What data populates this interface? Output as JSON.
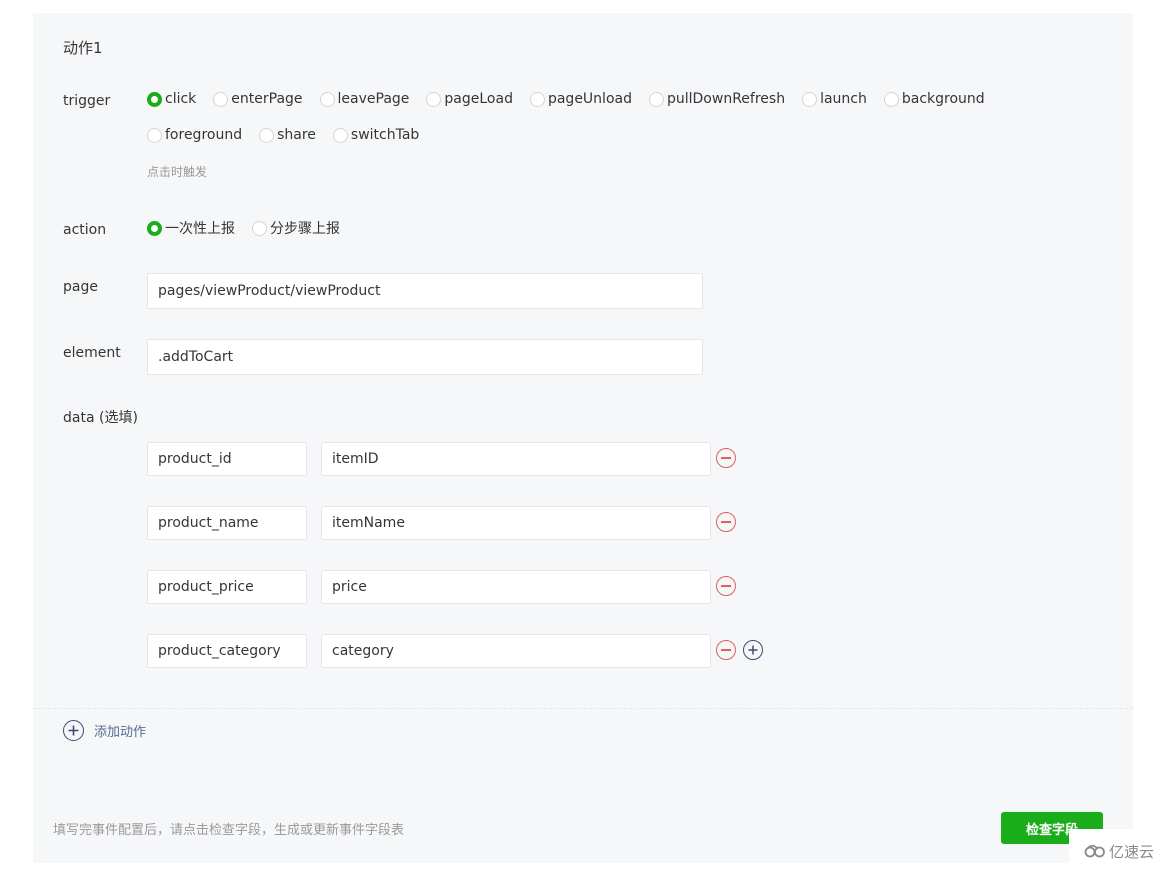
{
  "action": {
    "title": "动作1",
    "trigger": {
      "label": "trigger",
      "options_row1": [
        {
          "label": "click",
          "checked": true
        },
        {
          "label": "enterPage",
          "checked": false
        },
        {
          "label": "leavePage",
          "checked": false
        },
        {
          "label": "pageLoad",
          "checked": false
        },
        {
          "label": "pageUnload",
          "checked": false
        },
        {
          "label": "pullDownRefresh",
          "checked": false
        },
        {
          "label": "launch",
          "checked": false
        },
        {
          "label": "background",
          "checked": false
        }
      ],
      "options_row2": [
        {
          "label": "foreground",
          "checked": false
        },
        {
          "label": "share",
          "checked": false
        },
        {
          "label": "switchTab",
          "checked": false
        }
      ],
      "hint": "点击时触发"
    },
    "report": {
      "label": "action",
      "options": [
        {
          "label": "一次性上报",
          "checked": true
        },
        {
          "label": "分步骤上报",
          "checked": false
        }
      ]
    },
    "page": {
      "label": "page",
      "value": "pages/viewProduct/viewProduct"
    },
    "element": {
      "label": "element",
      "value": ".addToCart"
    },
    "data": {
      "label": "data (选填)",
      "rows": [
        {
          "key": "product_id",
          "value": "itemID"
        },
        {
          "key": "product_name",
          "value": "itemName"
        },
        {
          "key": "product_price",
          "value": "price"
        },
        {
          "key": "product_category",
          "value": "category"
        }
      ]
    }
  },
  "add_action_label": "添加动作",
  "footer": {
    "hint": "填写完事件配置后，请点击检查字段，生成或更新事件字段表",
    "check_button": "检查字段"
  },
  "watermark": "亿速云",
  "colors": {
    "accent_green": "#1aad19",
    "danger_red": "#e15f63",
    "link_blue": "#576b95",
    "panel_bg": "#f6f7f9"
  }
}
